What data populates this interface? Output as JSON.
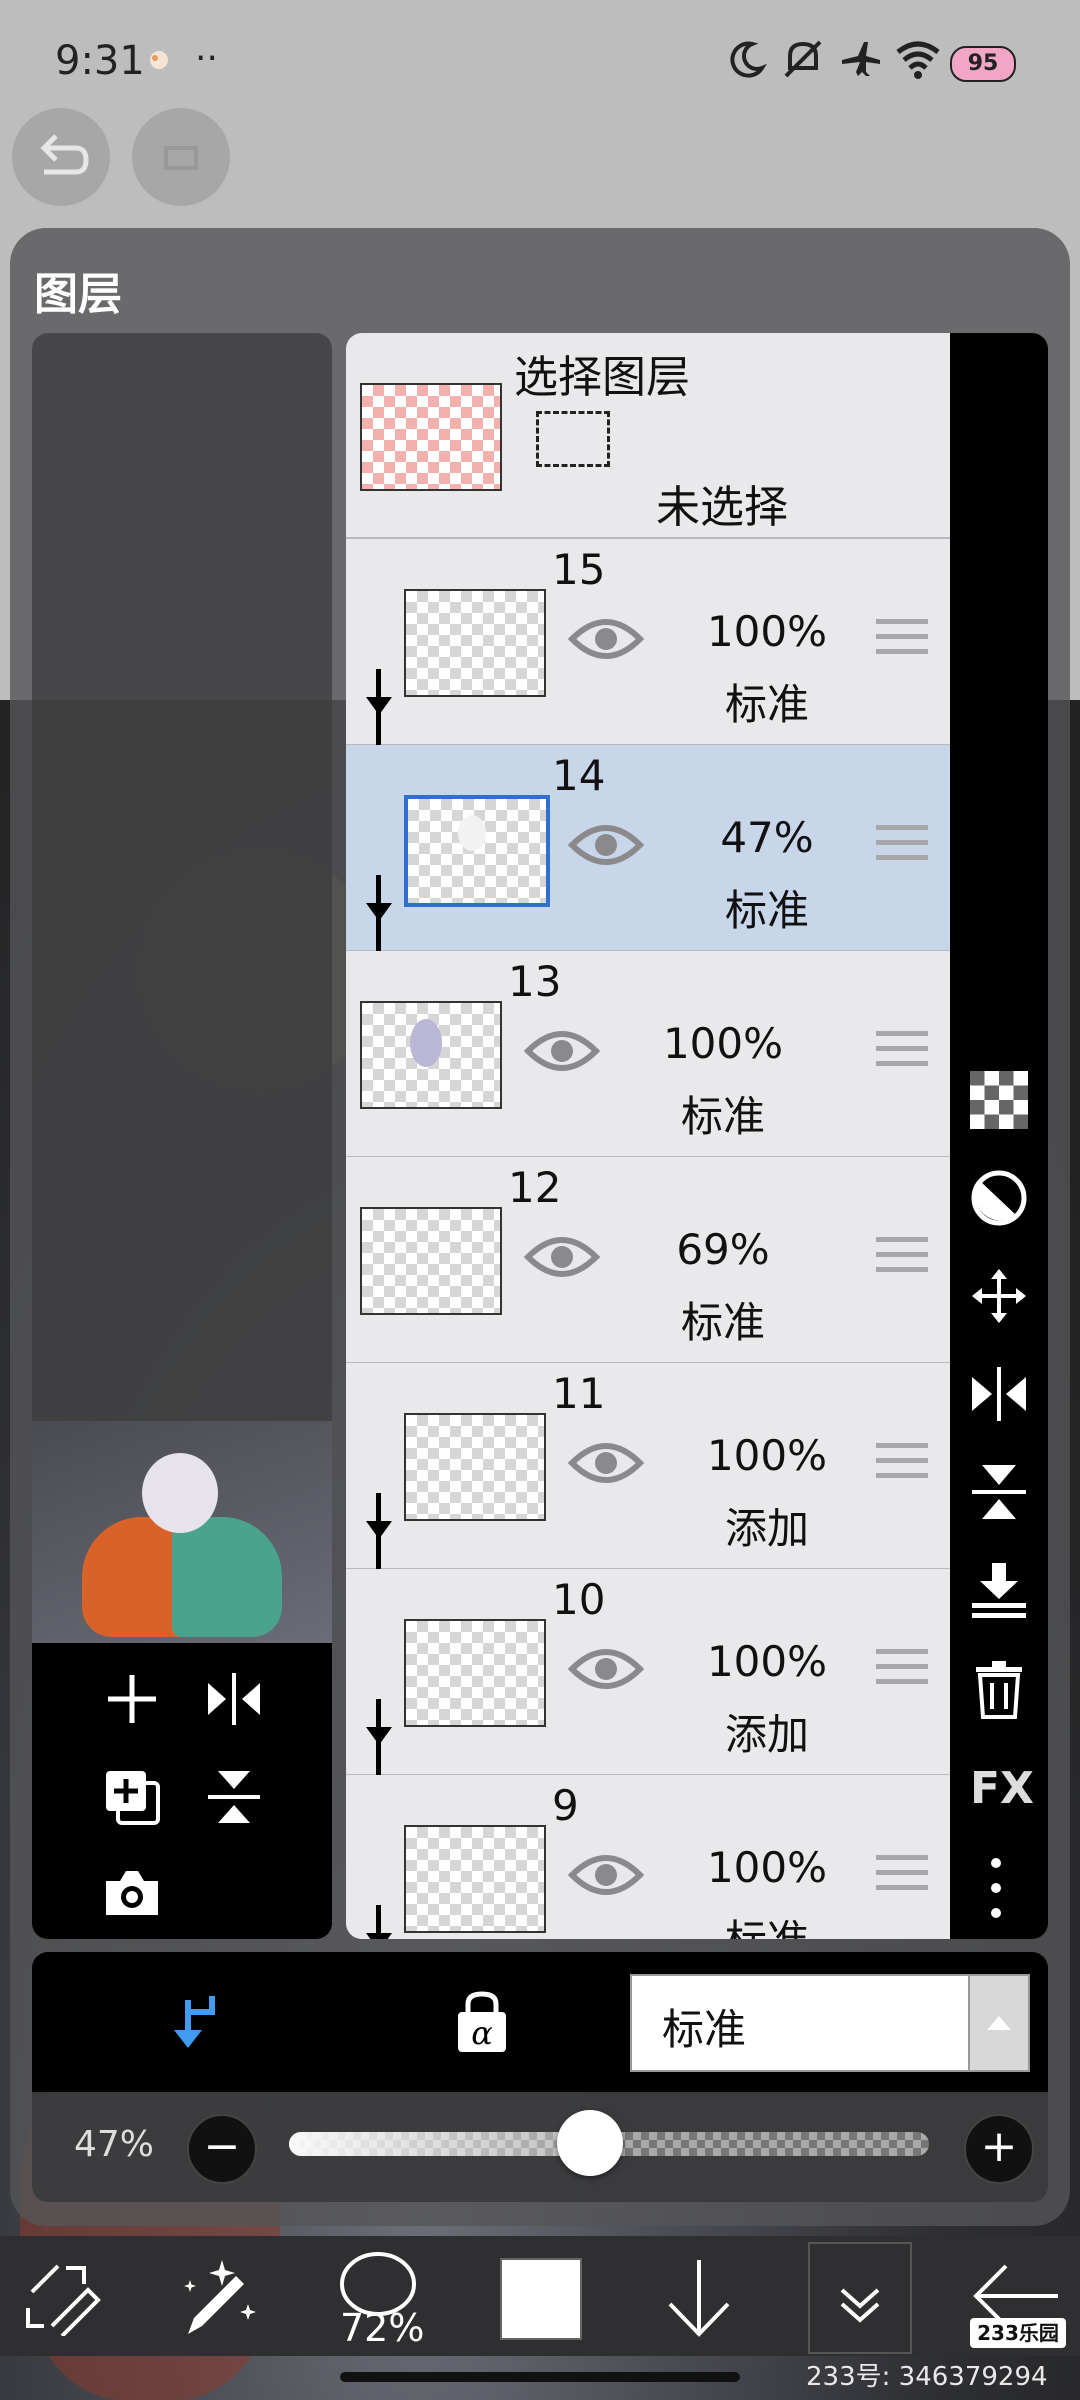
{
  "status_bar": {
    "time": "9:31",
    "dots": "··",
    "battery": "95"
  },
  "panel": {
    "title": "图层"
  },
  "select_layer": {
    "title": "选择图层",
    "status": "未选择"
  },
  "layers": [
    {
      "number": "15",
      "opacity": "100%",
      "blend": "标准"
    },
    {
      "number": "14",
      "opacity": "47%",
      "blend": "标准",
      "selected": true
    },
    {
      "number": "13",
      "opacity": "100%",
      "blend": "标准"
    },
    {
      "number": "12",
      "opacity": "69%",
      "blend": "标准"
    },
    {
      "number": "11",
      "opacity": "100%",
      "blend": "添加"
    },
    {
      "number": "10",
      "opacity": "100%",
      "blend": "添加"
    },
    {
      "number": "9",
      "opacity": "100%",
      "blend": "标准"
    }
  ],
  "right_toolbar": {
    "fx_label": "FX"
  },
  "blend_mode": {
    "value": "标准"
  },
  "opacity": {
    "label": "47%",
    "value": 0.47
  },
  "bottom_toolbar": {
    "brush_size": "72%"
  },
  "watermark": {
    "brand": "233乐园",
    "uid": "233号: 346379294"
  }
}
